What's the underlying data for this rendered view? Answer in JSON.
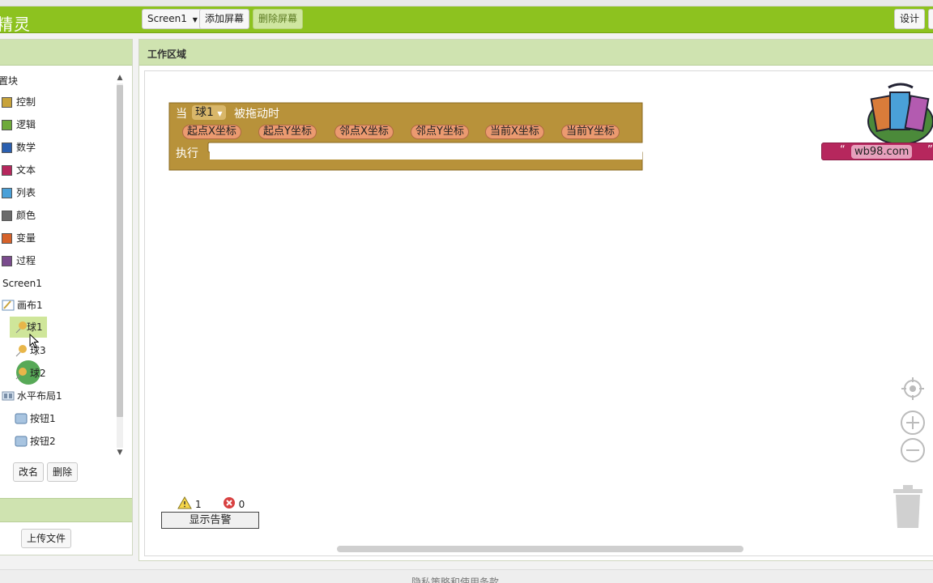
{
  "header": {
    "app_title": "精灵",
    "screen_dropdown": "Screen1",
    "add_screen": "添加屏幕",
    "remove_screen": "删除屏幕",
    "design_button": "设计"
  },
  "left_panel": {
    "builtin_section": "置块",
    "builtin_blocks": [
      {
        "label": "控制",
        "color": "#c8a33b"
      },
      {
        "label": "逻辑",
        "color": "#6eaa3a"
      },
      {
        "label": "数学",
        "color": "#2a5fb0"
      },
      {
        "label": "文本",
        "color": "#b6275d"
      },
      {
        "label": "列表",
        "color": "#4aa0d8"
      },
      {
        "label": "颜色",
        "color": "#6b6b6b"
      },
      {
        "label": "变量",
        "color": "#d6622a"
      },
      {
        "label": "过程",
        "color": "#7a4b8d"
      }
    ],
    "screen": "Screen1",
    "components": {
      "canvas": "画布1",
      "ball1": "球1",
      "ball3": "球3",
      "ball2": "球2",
      "hlayout": "水平布局1",
      "button1": "按钮1",
      "button2": "按钮2"
    },
    "rename_button": "改名",
    "delete_button": "删除",
    "upload_button": "上传文件"
  },
  "workspace": {
    "title": "工作区域",
    "block": {
      "when": "当",
      "component": "球1",
      "event": "被拖动时",
      "params": [
        "起点X坐标",
        "起点Y坐标",
        "邻点X坐标",
        "邻点Y坐标",
        "当前X坐标",
        "当前Y坐标"
      ],
      "do": "执行",
      "color": "#b8923a"
    },
    "text_block": {
      "open_quote": "“",
      "value": "wb98.com",
      "close_quote": "”",
      "color": "#b6275d"
    },
    "warnings_count": "1",
    "errors_count": "0",
    "show_warnings": "显示告警"
  },
  "footer": {
    "text": "隐私策略和使用条款"
  }
}
